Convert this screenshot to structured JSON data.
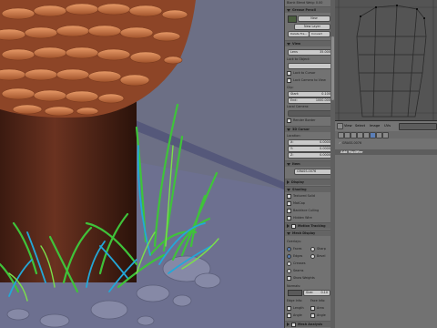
{
  "npanel": {
    "top_label": "Blank Blend Weig: 0.00",
    "grease_pencil_header": "Grease Pencil",
    "new_button": "New",
    "new_layer_button": "New Layer",
    "delete_frame_button": "Delete Fra...",
    "convert_button": "Convert",
    "view_header": "View",
    "lens_label": "Lens",
    "lens_value": "35.000",
    "lock_to_object_label": "Lock to Object:",
    "lock_to_cursor_label": "Lock to Cursor",
    "lock_camera_label": "Lock Camera to View",
    "clip_label": "Clip:",
    "clip_start_label": "Start:",
    "clip_start_value": "0.100",
    "clip_end_label": "End:",
    "clip_end_value": "1000.000",
    "local_camera_label": "Local Camera:",
    "render_border_label": "Render Border",
    "cursor_header": "3D Cursor",
    "location_label": "Location:",
    "cursor_x_label": "X:",
    "cursor_x_value": "0.0000",
    "cursor_y_label": "Y:",
    "cursor_y_value": "0.0000",
    "cursor_z_label": "Z:",
    "cursor_z_value": "0.0000",
    "item_header": "Item",
    "item_name": "GRASS.0076",
    "display_header": "Display",
    "shading_header": "Shading",
    "textured_solid_label": "Textured Solid",
    "matcap_label": "MatCap",
    "backface_culling_label": "Backface Culling",
    "hidden_wire_label": "Hidden Wire",
    "motion_tracking_header": "Motion Tracking",
    "mesh_display_header": "Mesh Display",
    "overlays_label": "Overlays:",
    "faces_label": "Faces",
    "sharp_label": "Sharp",
    "edges_label": "Edges",
    "bevel_label": "Bevel",
    "creases_label": "Creases",
    "seams_label": "Seams",
    "show_weights_label": "Show Weights",
    "normals_label": "Normals:",
    "size_label": "Size:",
    "size_value": "0.10",
    "edge_info_label": "Edge Info:",
    "face_info_label": "Face Info:",
    "length_label": "Length",
    "area_label": "Area",
    "angle_label": "Angle",
    "angle2_label": "Angle",
    "mesh_analysis_header": "Mesh Analysis"
  },
  "right_header": {
    "view_menu": "View",
    "select_menu": "Select",
    "image_menu": "Image",
    "uvs_menu": "UVs"
  },
  "props": {
    "object_name": "GRASS.0076",
    "add_modifier_button": "Add Modifier"
  }
}
